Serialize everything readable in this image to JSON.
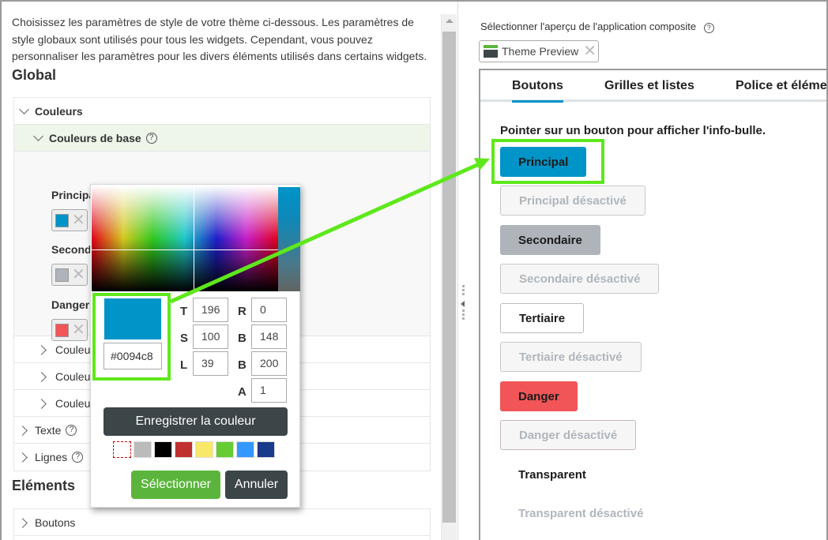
{
  "left_panel": {
    "intro": "Choisissez les paramètres de style de votre thème ci-dessous. Les paramètres de style globaux sont utilisés pour tous les widgets. Cependant, vous pouvez personnaliser les paramètres pour les divers éléments utilisés dans certains widgets.",
    "global_heading": "Global",
    "elements_heading": "Eléments",
    "global_sections": {
      "colors": "Couleurs",
      "base_colors": "Couleurs de base",
      "fields": [
        {
          "label": "Principal",
          "color": "#0094c8"
        },
        {
          "label": "Secondaire",
          "color": "#aeb4ba"
        },
        {
          "label": "Danger",
          "color": "#f15557"
        }
      ],
      "sub_sections": [
        "Couleurs",
        "Couleurs",
        "Couleurs"
      ],
      "text": "Texte",
      "lines": "Lignes"
    },
    "elements_sections": [
      "Boutons"
    ]
  },
  "color_picker": {
    "current_color": "#0094c8",
    "hex_value": "#0094c8",
    "hsl": {
      "T_label": "T",
      "T": "196",
      "S_label": "S",
      "S": "100",
      "L_label": "L",
      "L": "39"
    },
    "rgba": {
      "R_label": "R",
      "R": "0",
      "G_label": "B",
      "G": "148",
      "B_label": "B",
      "B": "200",
      "A_label": "A",
      "A": "1"
    },
    "save_color_label": "Enregistrer la couleur",
    "palette": [
      "empty",
      "#bbbbbb",
      "#000000",
      "#c03030",
      "#f8e86a",
      "#66cc33",
      "#3399ff",
      "#1a3a8a"
    ],
    "select_label": "Sélectionner",
    "cancel_label": "Annuler"
  },
  "right_panel": {
    "select_preview_label": "Sélectionner l'aperçu de l'application composite",
    "help_glyph": "?",
    "chip_label": "Theme Preview",
    "tabs": [
      {
        "label": "Boutons",
        "active": true
      },
      {
        "label": "Grilles et listes",
        "active": false
      },
      {
        "label": "Police et élémen",
        "active": false
      }
    ],
    "hint": "Pointer sur un bouton pour afficher l'info-bulle.",
    "buttons": [
      {
        "label": "Principal",
        "style": "primary"
      },
      {
        "label": "Principal désactivé",
        "style": "disabled"
      },
      {
        "label": "Secondaire",
        "style": "secondary"
      },
      {
        "label": "Secondaire désactivé",
        "style": "disabled"
      },
      {
        "label": "Tertiaire",
        "style": "tertiary"
      },
      {
        "label": "Tertiaire désactivé",
        "style": "disabled"
      },
      {
        "label": "Danger",
        "style": "danger"
      },
      {
        "label": "Danger désactivé",
        "style": "disabled"
      },
      {
        "label": "Transparent",
        "style": "transparent"
      },
      {
        "label": "Transparent désactivé",
        "style": "transparent-disabled"
      }
    ]
  },
  "colors": {
    "accent": "#0094c8",
    "highlight": "#5ee81c",
    "save_green": "#5bb53c",
    "dark": "#3c4548"
  }
}
